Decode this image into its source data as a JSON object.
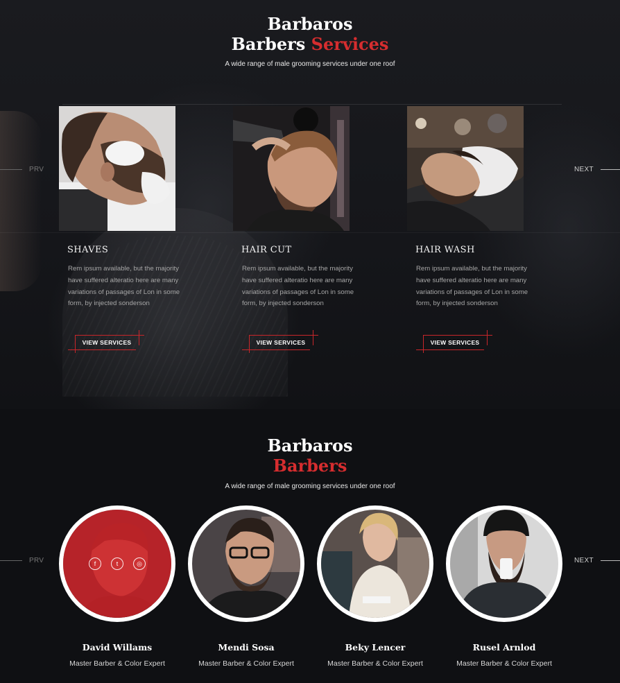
{
  "services_section": {
    "title_line1": "Barbaros",
    "title_line2_white": "Barbers",
    "title_line2_red": "Services",
    "subtitle": "A wide range of male grooming services under one roof",
    "prev_label": "PRV",
    "next_label": "NEXT",
    "items": [
      {
        "title": "SHAVES",
        "text": "Rem ipsum available, but the majority have suffered alteratio here are many variations of passages of Lon in some form, by injected sonderson",
        "button": "VIEW SERVICES"
      },
      {
        "title": "HAIR CUT",
        "text": "Rem ipsum available, but the majority have suffered alteratio here are many variations of passages of Lon in some form, by injected sonderson",
        "button": "VIEW SERVICES"
      },
      {
        "title": "HAIR WASH",
        "text": "Rem ipsum available, but the majority have suffered alteratio here are many variations of passages of Lon in some form, by injected sonderson",
        "button": "VIEW SERVICES"
      }
    ]
  },
  "team_section": {
    "title_line1": "Barbaros",
    "title_line2_red": "Barbers",
    "subtitle": "A wide range of male grooming services under one roof",
    "prev_label": "PRV",
    "next_label": "NEXT",
    "social_icons": [
      "facebook-icon",
      "twitter-icon",
      "instagram-icon"
    ],
    "social_glyphs": [
      "f",
      "t",
      "◎"
    ],
    "members": [
      {
        "name": "David Willams",
        "role": "Master Barber & Color Expert"
      },
      {
        "name": "Mendi Sosa",
        "role": "Master Barber & Color Expert"
      },
      {
        "name": "Beky Lencer",
        "role": "Master Barber & Color Expert"
      },
      {
        "name": "Rusel Arnlod",
        "role": "Master Barber & Color Expert"
      }
    ]
  },
  "colors": {
    "accent": "#d62d2f",
    "background": "#0f1013",
    "text_muted": "#a7a7a7"
  }
}
